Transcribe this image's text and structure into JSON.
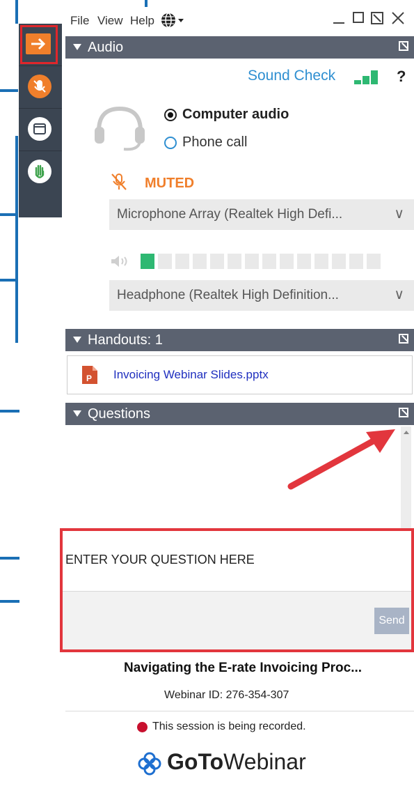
{
  "menu": {
    "file": "File",
    "view": "View",
    "help": "Help"
  },
  "audio": {
    "header": "Audio",
    "sound_check": "Sound Check",
    "help_mark": "?",
    "computer_audio": "Computer audio",
    "phone_call": "Phone call",
    "muted": "MUTED",
    "microphone": "Microphone Array (Realtek High Defi...",
    "headphone": "Headphone (Realtek High Definition..."
  },
  "handouts": {
    "header": "Handouts: 1",
    "file_name": "Invoicing Webinar Slides.pptx",
    "file_badge": "P"
  },
  "questions": {
    "header": "Questions",
    "placeholder": "ENTER YOUR QUESTION HERE",
    "send_label": "Send"
  },
  "footer": {
    "webinar_title": "Navigating the E-rate Invoicing Proc...",
    "webinar_id": "Webinar ID: 276-354-307",
    "recording": "This session is being recorded.",
    "logo_goto": "GoTo",
    "logo_webinar": "Webinar"
  },
  "colors": {
    "callout_blue": "#1a6fb5",
    "highlight_red": "#e2363d",
    "panel_header": "#5b6270",
    "accent_orange": "#f07f2b",
    "link_blue": "#2f8fd1",
    "meter_green": "#2eb872"
  },
  "icons": [
    "globe-icon",
    "minimize-icon",
    "maximize-icon",
    "popout-icon",
    "close-icon",
    "arrow-right-icon",
    "mic-muted-icon",
    "screen-icon",
    "hand-icon",
    "headset-icon",
    "speaker-icon",
    "chevron-down-icon",
    "powerpoint-icon",
    "record-dot-icon",
    "gotowebinar-logo-icon"
  ]
}
